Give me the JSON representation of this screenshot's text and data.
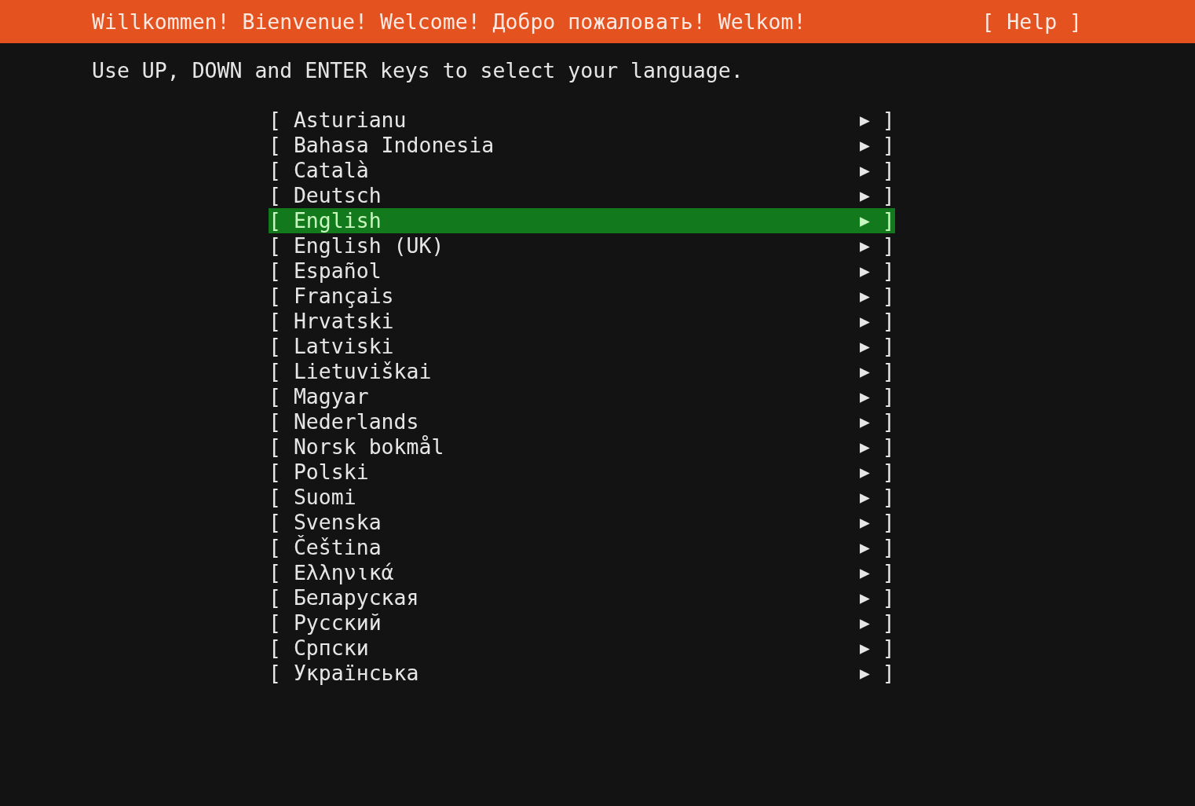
{
  "header": {
    "title": "Willkommen! Bienvenue! Welcome! Добро пожаловать! Welkom!",
    "help_button": "[ Help ]"
  },
  "instruction": "Use UP, DOWN and ENTER keys to select your language.",
  "languages": [
    {
      "open": "[",
      "label": "Asturianu",
      "arrow": "▶",
      "close": "]",
      "selected": false
    },
    {
      "open": "[",
      "label": "Bahasa Indonesia",
      "arrow": "▶",
      "close": "]",
      "selected": false
    },
    {
      "open": "[",
      "label": "Català",
      "arrow": "▶",
      "close": "]",
      "selected": false
    },
    {
      "open": "[",
      "label": "Deutsch",
      "arrow": "▶",
      "close": "]",
      "selected": false
    },
    {
      "open": "[",
      "label": "English",
      "arrow": "▶",
      "close": "]",
      "selected": true
    },
    {
      "open": "[",
      "label": "English (UK)",
      "arrow": "▶",
      "close": "]",
      "selected": false
    },
    {
      "open": "[",
      "label": "Español",
      "arrow": "▶",
      "close": "]",
      "selected": false
    },
    {
      "open": "[",
      "label": "Français",
      "arrow": "▶",
      "close": "]",
      "selected": false
    },
    {
      "open": "[",
      "label": "Hrvatski",
      "arrow": "▶",
      "close": "]",
      "selected": false
    },
    {
      "open": "[",
      "label": "Latviski",
      "arrow": "▶",
      "close": "]",
      "selected": false
    },
    {
      "open": "[",
      "label": "Lietuviškai",
      "arrow": "▶",
      "close": "]",
      "selected": false
    },
    {
      "open": "[",
      "label": "Magyar",
      "arrow": "▶",
      "close": "]",
      "selected": false
    },
    {
      "open": "[",
      "label": "Nederlands",
      "arrow": "▶",
      "close": "]",
      "selected": false
    },
    {
      "open": "[",
      "label": "Norsk bokmål",
      "arrow": "▶",
      "close": "]",
      "selected": false
    },
    {
      "open": "[",
      "label": "Polski",
      "arrow": "▶",
      "close": "]",
      "selected": false
    },
    {
      "open": "[",
      "label": "Suomi",
      "arrow": "▶",
      "close": "]",
      "selected": false
    },
    {
      "open": "[",
      "label": "Svenska",
      "arrow": "▶",
      "close": "]",
      "selected": false
    },
    {
      "open": "[",
      "label": "Čeština",
      "arrow": "▶",
      "close": "]",
      "selected": false
    },
    {
      "open": "[",
      "label": "Ελληνικά",
      "arrow": "▶",
      "close": "]",
      "selected": false
    },
    {
      "open": "[",
      "label": "Беларуская",
      "arrow": "▶",
      "close": "]",
      "selected": false
    },
    {
      "open": "[",
      "label": "Русский",
      "arrow": "▶",
      "close": "]",
      "selected": false
    },
    {
      "open": "[",
      "label": "Српски",
      "arrow": "▶",
      "close": "]",
      "selected": false
    },
    {
      "open": "[",
      "label": "Українська",
      "arrow": "▶",
      "close": "]",
      "selected": false
    }
  ]
}
